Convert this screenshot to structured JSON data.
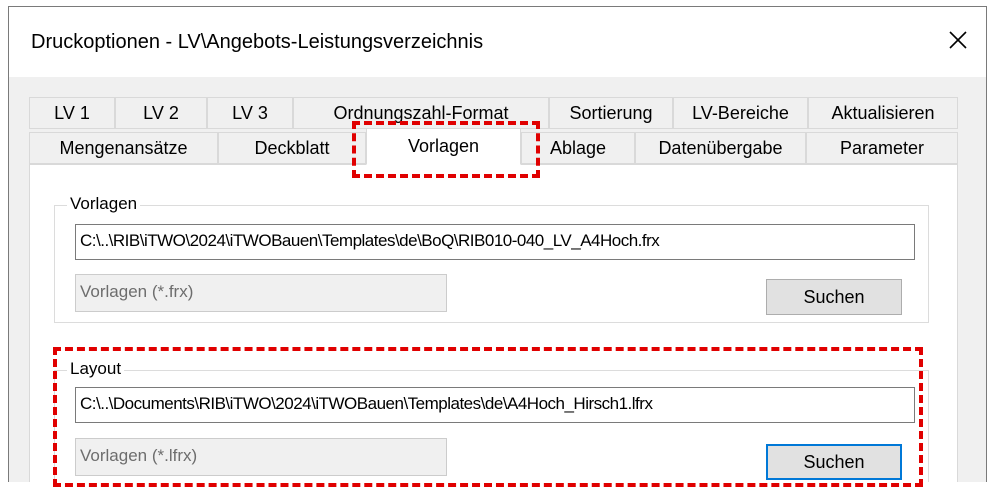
{
  "window": {
    "title": "Druckoptionen - LV\\Angebots-Leistungsverzeichnis"
  },
  "tabs_row1": [
    "LV 1",
    "LV 2",
    "LV 3",
    "Ordnungszahl-Format",
    "Sortierung",
    "LV-Bereiche",
    "Aktualisieren"
  ],
  "tabs_row2": [
    "Mengenansätze",
    "Deckblatt",
    "Vorlagen",
    "Ablage",
    "Datenübergabe",
    "Parameter"
  ],
  "active_tab": "Vorlagen",
  "vorlagen_group": {
    "label": "Vorlagen",
    "path": "C:\\..\\RIB\\iTWO\\2024\\iTWOBauen\\Templates\\de\\BoQ\\RIB010-040_LV_A4Hoch.frx",
    "filter": "Vorlagen (*.frx)",
    "button": "Suchen"
  },
  "layout_group": {
    "label": "Layout",
    "path": "C:\\..\\Documents\\RIB\\iTWO\\2024\\iTWOBauen\\Templates\\de\\A4Hoch_Hirsch1.lfrx",
    "filter": "Vorlagen (*.lfrx)",
    "button": "Suchen"
  },
  "colors": {
    "highlight": "#e00000",
    "focus": "#0078d7"
  },
  "icons": {
    "close": "close-icon"
  }
}
